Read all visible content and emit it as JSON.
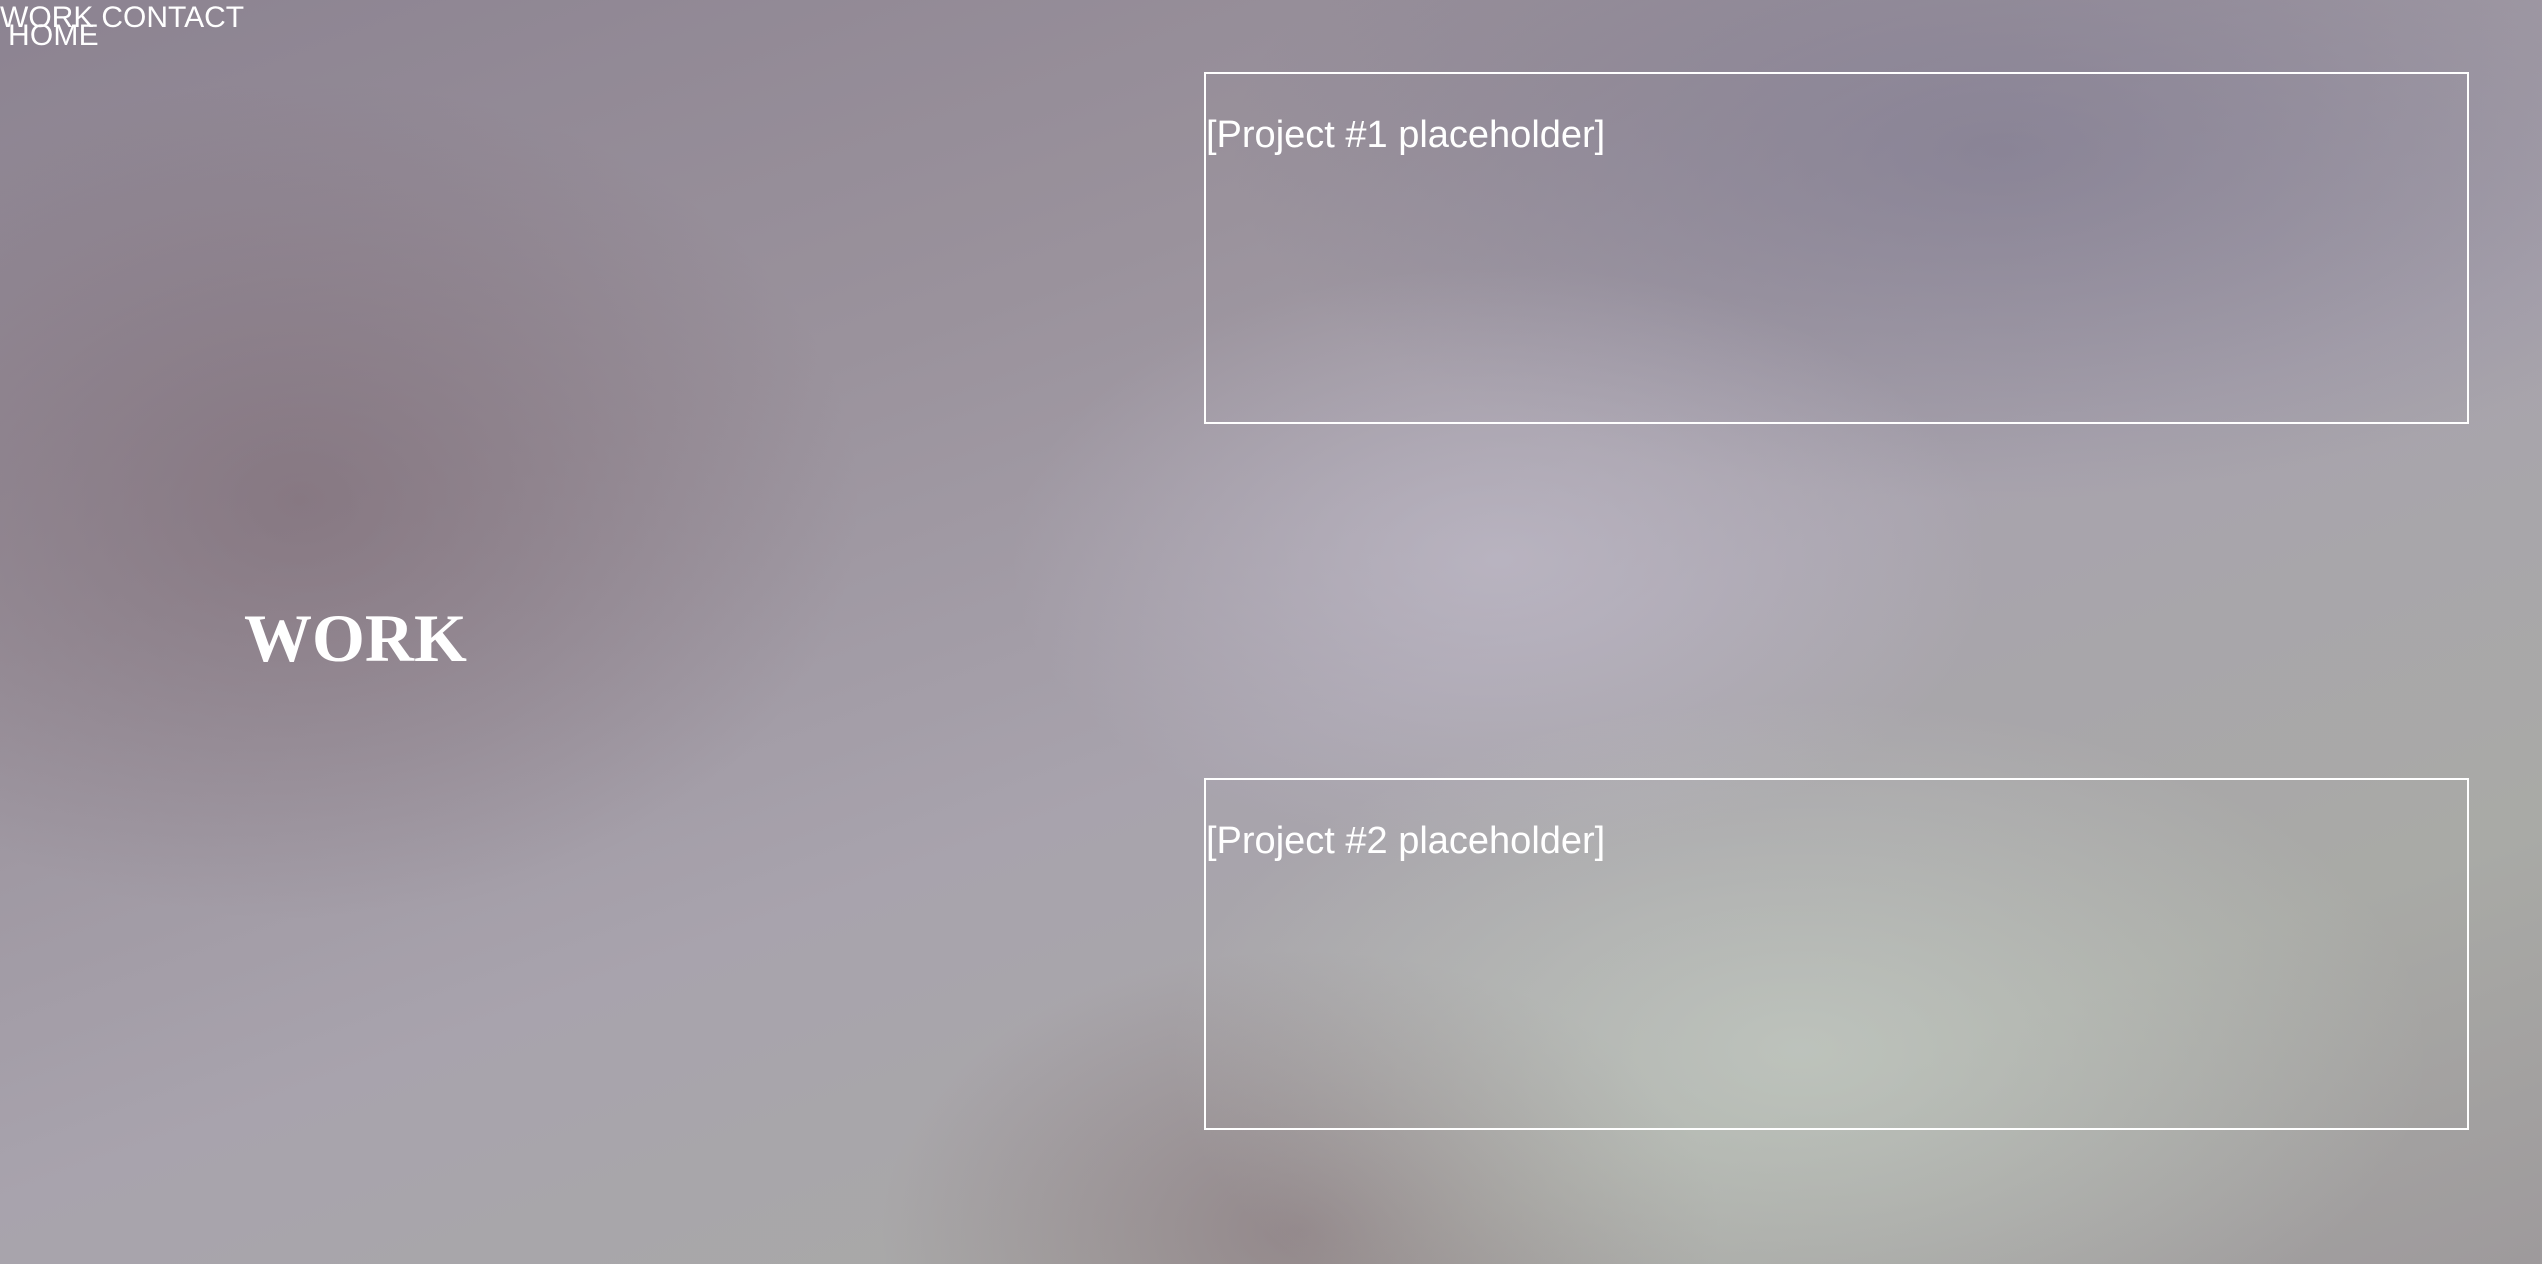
{
  "nav": {
    "home_label": "HOME",
    "work_label": "WORK",
    "contact_label": "CONTACT"
  },
  "section": {
    "title": "WORK"
  },
  "projects": [
    {
      "label": "[Project #1 placeholder]"
    },
    {
      "label": "[Project #2 placeholder]"
    }
  ],
  "colors": {
    "text": "#ffffff",
    "border": "#ffffff"
  }
}
